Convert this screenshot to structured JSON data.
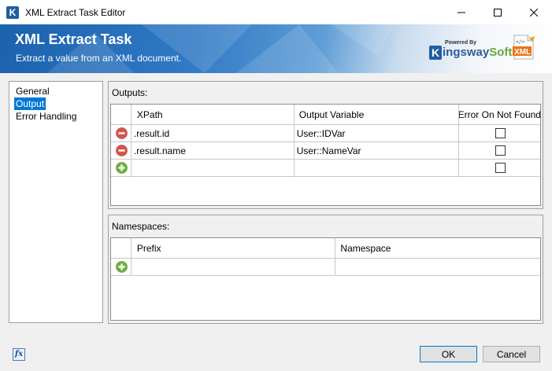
{
  "window": {
    "title": "XML Extract Task Editor",
    "app_icon_glyph": "K"
  },
  "banner": {
    "title": "XML Extract Task",
    "subtitle": "Extract a value from an XML document.",
    "brand_powered": "Powered By",
    "brand_k": "K",
    "brand_name_1": "ingsway",
    "brand_name_2": "Soft",
    "xml_logo_text": "XML",
    "xml_logo_tag": "</>"
  },
  "nav": {
    "items": [
      {
        "label": "General",
        "selected": false
      },
      {
        "label": "Output",
        "selected": true
      },
      {
        "label": "Error Handling",
        "selected": false
      }
    ]
  },
  "outputs": {
    "title": "Outputs:",
    "columns": [
      "XPath",
      "Output Variable",
      "Error On Not Found"
    ],
    "rows": [
      {
        "xpath": ".result.id",
        "variable": "User::IDVar",
        "error_on_not_found": false
      },
      {
        "xpath": ".result.name",
        "variable": "User::NameVar",
        "error_on_not_found": false
      }
    ],
    "new_row": {
      "xpath": "",
      "variable": "",
      "error_on_not_found": false
    }
  },
  "namespaces": {
    "title": "Namespaces:",
    "columns": [
      "Prefix",
      "Namespace"
    ],
    "new_row": {
      "prefix": "",
      "namespace": ""
    }
  },
  "footer": {
    "fx_label": "fx",
    "ok_label": "OK",
    "cancel_label": "Cancel"
  },
  "colors": {
    "selection": "#0078d7",
    "remove_icon": "#d9534f",
    "add_icon": "#6cb33f",
    "banner_blue": "#1c62ad"
  },
  "icons": {
    "remove": "remove-row-icon",
    "add": "add-row-icon",
    "minimize": "minimize-icon",
    "maximize": "maximize-icon",
    "close": "close-icon",
    "expression": "expression-icon"
  }
}
